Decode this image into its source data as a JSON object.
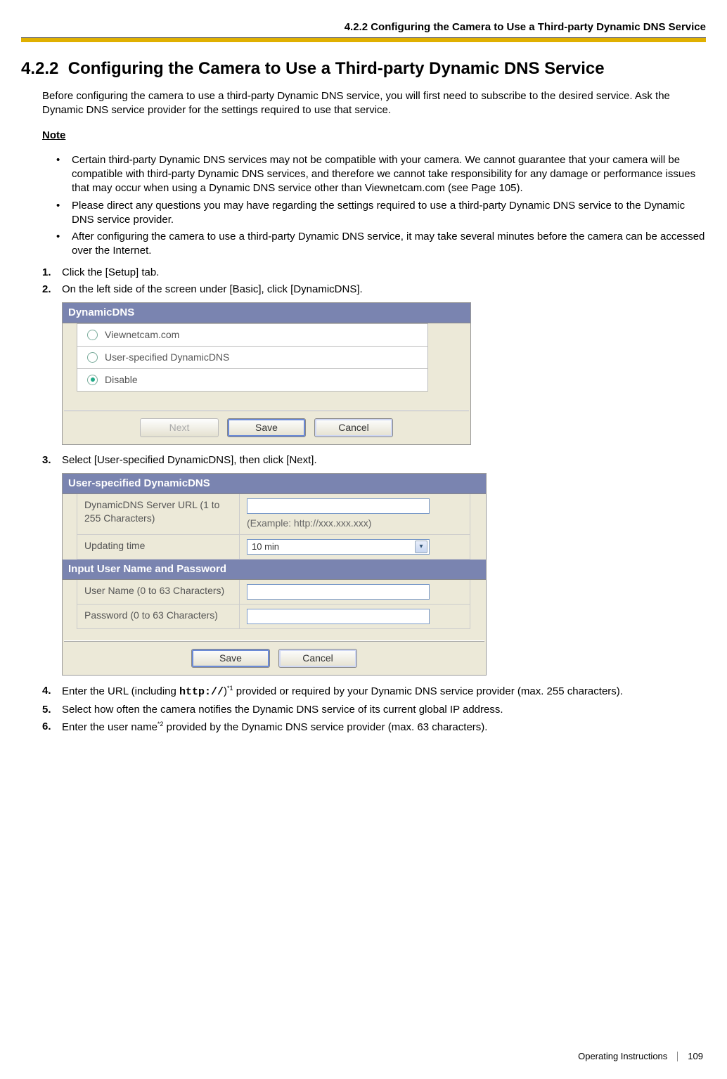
{
  "header": {
    "breadcrumb": "4.2.2 Configuring the Camera to Use a Third-party Dynamic DNS Service"
  },
  "heading": {
    "num": "4.2.2",
    "title": "Configuring the Camera to Use a Third-party Dynamic DNS Service"
  },
  "intro": "Before configuring the camera to use a third-party Dynamic DNS service, you will first need to subscribe to the desired service. Ask the Dynamic DNS service provider for the settings required to use that service.",
  "note_label": "Note",
  "notes": [
    "Certain third-party Dynamic DNS services may not be compatible with your camera. We cannot guarantee that your camera will be compatible with third-party Dynamic DNS services, and therefore we cannot take responsibility for any damage or performance issues that may occur when using a Dynamic DNS service other than Viewnetcam.com (see Page 105).",
    "Please direct any questions you may have regarding the settings required to use a third-party Dynamic DNS service to the Dynamic DNS service provider.",
    "After configuring the camera to use a third-party Dynamic DNS service, it may take several minutes before the camera can be accessed over the Internet."
  ],
  "steps": {
    "s1": "Click the [Setup] tab.",
    "s2": "On the left side of the screen under [Basic], click [DynamicDNS].",
    "s3": "Select [User-specified DynamicDNS], then click [Next].",
    "s4_a": "Enter the URL (including ",
    "s4_code": "http://",
    "s4_b": ")",
    "s4_sup": "*1",
    "s4_c": " provided or required by your Dynamic DNS service provider (max. 255 characters).",
    "s5": "Select how often the camera notifies the Dynamic DNS service of its current global IP address.",
    "s6_a": "Enter the user name",
    "s6_sup": "*2",
    "s6_b": " provided by the Dynamic DNS service provider (max. 63 characters)."
  },
  "panel1": {
    "title": "DynamicDNS",
    "opt1": "Viewnetcam.com",
    "opt2": "User-specified DynamicDNS",
    "opt3": "Disable",
    "btn_next": "Next",
    "btn_save": "Save",
    "btn_cancel": "Cancel"
  },
  "panel2": {
    "title1": "User-specified DynamicDNS",
    "row_url_label": "DynamicDNS Server URL (1 to 255 Characters)",
    "row_url_example": "(Example: http://xxx.xxx.xxx)",
    "row_update_label": "Updating time",
    "row_update_value": "10 min",
    "title2": "Input User Name and Password",
    "row_user_label": "User Name (0 to 63 Characters)",
    "row_pass_label": "Password (0 to 63 Characters)",
    "btn_save": "Save",
    "btn_cancel": "Cancel"
  },
  "footer": {
    "label": "Operating Instructions",
    "page": "109"
  }
}
